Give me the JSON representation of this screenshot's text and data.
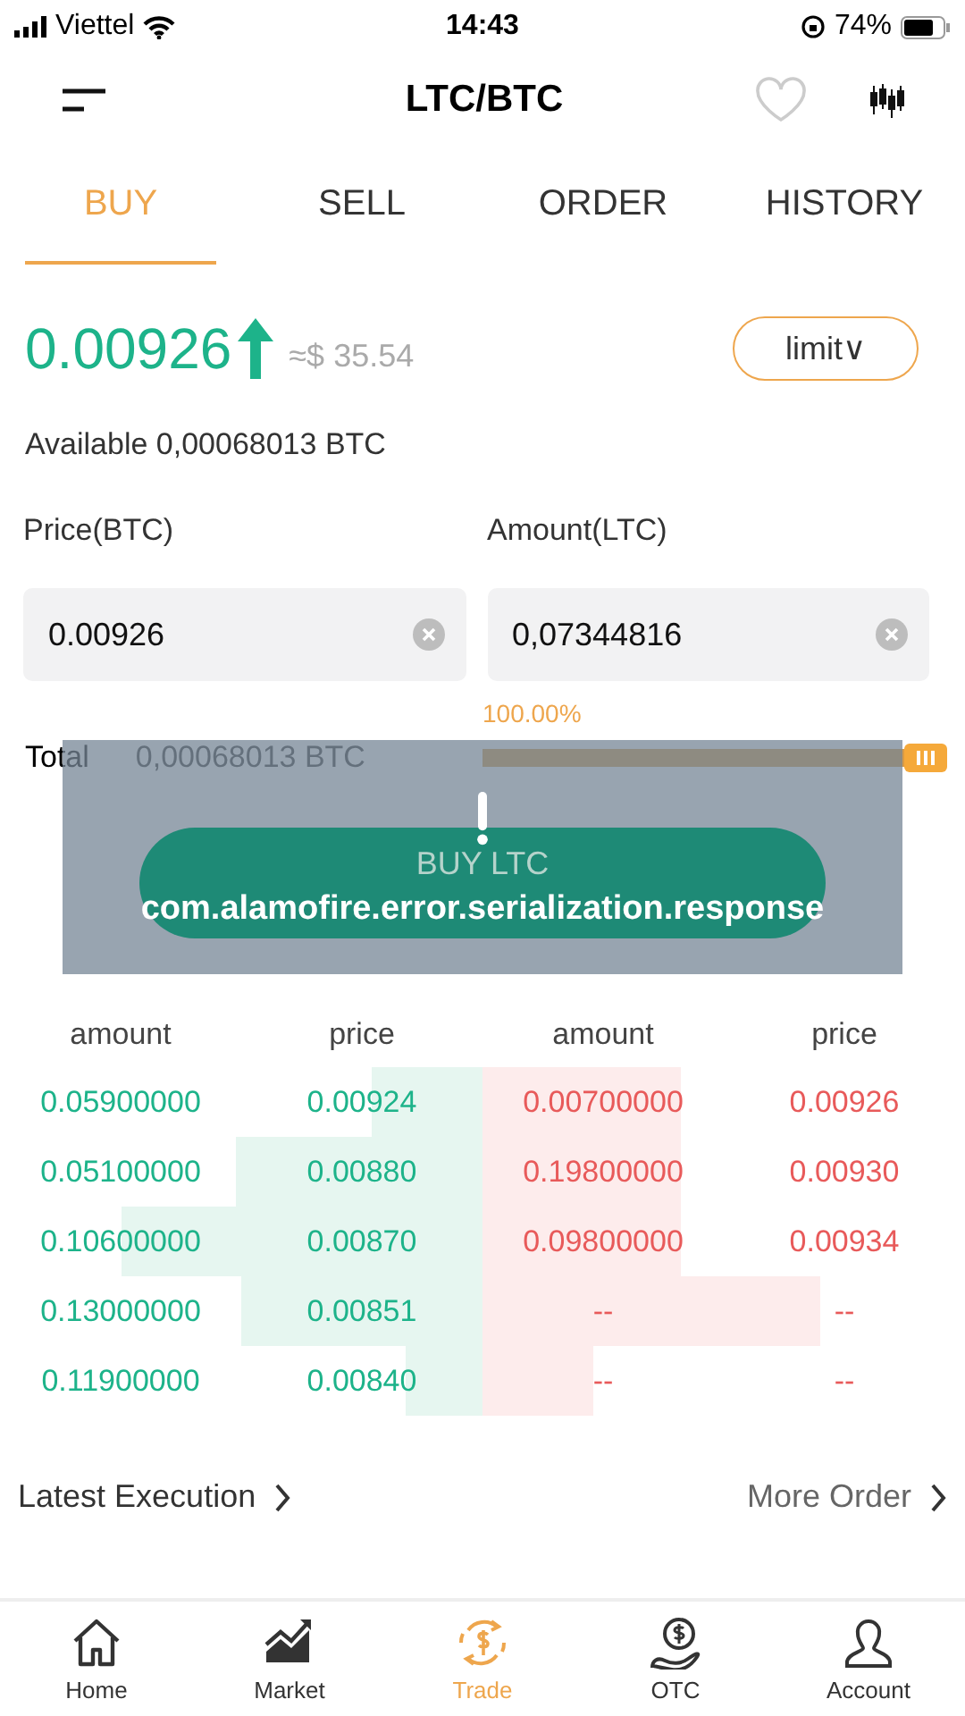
{
  "status_bar": {
    "carrier": "Viettel",
    "time": "14:43",
    "battery": "74%"
  },
  "header": {
    "title": "LTC/BTC",
    "favorite": false
  },
  "tabs": [
    {
      "label": "BUY",
      "selected": true
    },
    {
      "label": "SELL",
      "selected": false
    },
    {
      "label": "ORDER",
      "selected": false
    },
    {
      "label": "HISTORY",
      "selected": false
    }
  ],
  "price": {
    "value": "0.00926",
    "fiat": "≈$ 35.54",
    "order_type": "limit∨"
  },
  "available": "Available 0,00068013 BTC",
  "fields": [
    {
      "label": "Price(BTC)",
      "value": "0.00926"
    },
    {
      "label": "Amount(LTC)",
      "value": "0,07344816"
    }
  ],
  "slider": {
    "reading": "100.00%",
    "level": 1
  },
  "total": {
    "label": "Total",
    "value": "0,00068013 BTC"
  },
  "buy_button": "BUY LTC",
  "toast": {
    "message": "com.alamofire.error.serialization.response"
  },
  "order_book": {
    "columns": [
      "amount",
      "price",
      "amount",
      "price"
    ],
    "bids": [
      {
        "amount": "0.05900000",
        "price": "0.00924"
      },
      {
        "amount": "0.05100000",
        "price": "0.00880"
      },
      {
        "amount": "0.10600000",
        "price": "0.00870"
      },
      {
        "amount": "0.13000000",
        "price": "0.00851"
      },
      {
        "amount": "0.11900000",
        "price": "0.00840"
      }
    ],
    "asks": [
      {
        "amount": "0.00700000",
        "price": "0.00926"
      },
      {
        "amount": "0.19800000",
        "price": "0.00930"
      },
      {
        "amount": "0.09800000",
        "price": "0.00934"
      },
      {
        "amount": "--",
        "price": "--"
      },
      {
        "amount": "--",
        "price": "--"
      }
    ]
  },
  "links": {
    "left": "Latest Execution",
    "right": "More Order"
  },
  "nav": [
    {
      "label": "Home",
      "selected": false
    },
    {
      "label": "Market",
      "selected": false
    },
    {
      "label": "Trade",
      "selected": true
    },
    {
      "label": "OTC",
      "selected": false
    },
    {
      "label": "Account",
      "selected": false
    }
  ]
}
